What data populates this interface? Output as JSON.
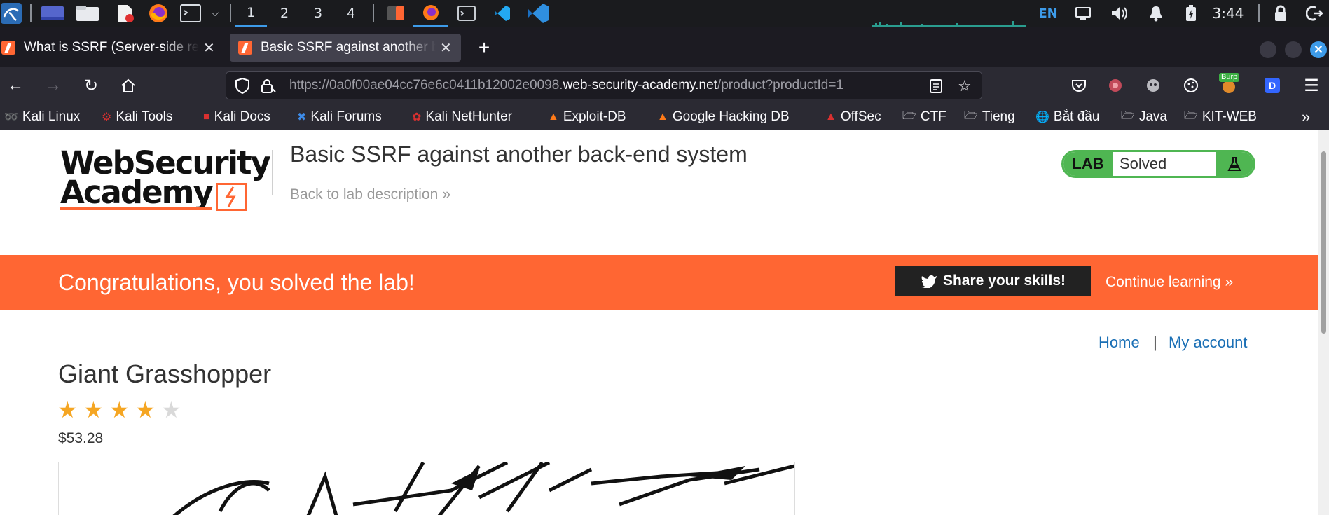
{
  "panel": {
    "workspaces": [
      "1",
      "2",
      "3",
      "4"
    ],
    "active_workspace": "1",
    "keyboard_layout": "EN",
    "clock": "3:44"
  },
  "tabs": [
    {
      "title": "What is SSRF (Server-side request forgery)?"
    },
    {
      "title": "Basic SSRF against another back-end system"
    }
  ],
  "url": {
    "prefix": "https://0a0f00ae04cc76e6c0411b12002e0098.",
    "domain": "web-security-academy.net",
    "path": "/product?productId=1"
  },
  "bookmarks": [
    {
      "label": "Kali Linux"
    },
    {
      "label": "Kali Tools"
    },
    {
      "label": "Kali Docs"
    },
    {
      "label": "Kali Forums"
    },
    {
      "label": "Kali NetHunter"
    },
    {
      "label": "Exploit-DB"
    },
    {
      "label": "Google Hacking DB"
    },
    {
      "label": "OffSec"
    },
    {
      "label": "CTF"
    },
    {
      "label": "Tieng"
    },
    {
      "label": "Bắt đầu"
    },
    {
      "label": "Java"
    },
    {
      "label": "KIT-WEB"
    }
  ],
  "extension_badge": "Burp",
  "header": {
    "logo_line1": "WebSecurity",
    "logo_line2": "Academy",
    "lab_title": "Basic SSRF against another back-end system",
    "back_link": "Back to lab description",
    "lab_label": "LAB",
    "lab_status": "Solved"
  },
  "banner": {
    "message": "Congratulations, you solved the lab!",
    "share": "Share your skills!",
    "continue": "Continue learning"
  },
  "nav": {
    "home": "Home",
    "separator": "|",
    "account": "My account"
  },
  "product": {
    "name": "Giant Grasshopper",
    "rating": 4,
    "rating_max": 5,
    "price": "$53.28"
  },
  "colors": {
    "accent": "#ff6633",
    "lab_green": "#4fb652",
    "link": "#1a6fb5"
  }
}
